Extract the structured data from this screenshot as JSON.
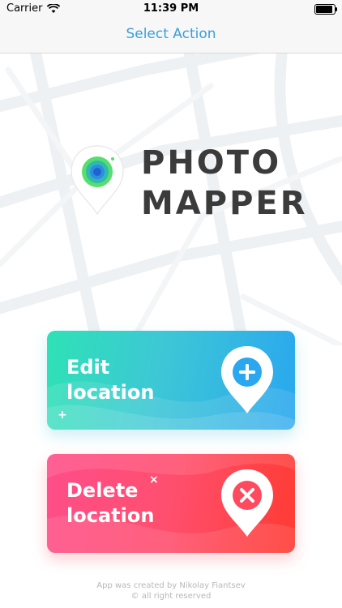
{
  "status_bar": {
    "carrier": "Carrier",
    "time": "11:39 PM"
  },
  "nav": {
    "title": "Select Action"
  },
  "logo": {
    "line1": "PHOTO",
    "line2": "MAPPER"
  },
  "actions": {
    "edit": {
      "line1": "Edit",
      "line2": "location",
      "icon": "plus-pin-icon"
    },
    "delete": {
      "line1": "Delete",
      "line2": "location",
      "icon": "x-pin-icon"
    }
  },
  "footer": {
    "line1": "App was created by Nikolay Fiantsev",
    "line2": "© all right reserved"
  },
  "colors": {
    "nav_accent": "#3a9fd8",
    "edit_gradient": [
      "#2ee2b5",
      "#2aa7ef"
    ],
    "delete_gradient": [
      "#ff4e8a",
      "#ff3b32"
    ]
  }
}
